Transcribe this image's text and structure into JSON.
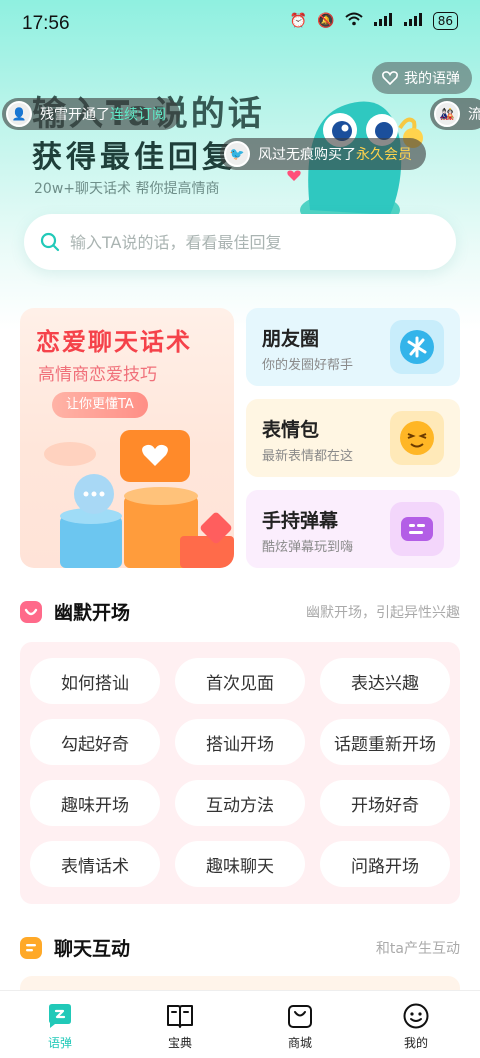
{
  "status_bar": {
    "time": "17:56",
    "battery": "86"
  },
  "hero": {
    "headline_line1": "输入Ta说的话",
    "headline_line2": "获得最佳回复",
    "subtitle": "20w+聊天话术 帮你提高情商",
    "my_danmu_label": "我的语弹"
  },
  "tickers": [
    {
      "prefix": "残雪开通了",
      "highlight": "连续订阅"
    },
    {
      "prefix": "风过无痕购买了",
      "highlight": "永久会员"
    },
    {
      "prefix": "流",
      "highlight": ""
    }
  ],
  "search": {
    "placeholder": "输入TA说的话，看看最佳回复"
  },
  "features": {
    "big": {
      "title": "恋爱聊天话术",
      "subtitle": "高情商恋爱技巧",
      "pill": "让你更懂TA"
    },
    "cards": [
      {
        "title": "朋友圈",
        "subtitle": "你的发圈好帮手"
      },
      {
        "title": "表情包",
        "subtitle": "最新表情都在这"
      },
      {
        "title": "手持弹幕",
        "subtitle": "酷炫弹幕玩到嗨"
      }
    ]
  },
  "section_humor": {
    "title": "幽默开场",
    "desc": "幽默开场，引起异性兴趣",
    "tags": [
      "如何搭讪",
      "首次见面",
      "表达兴趣",
      "勾起好奇",
      "搭讪开场",
      "话题重新开场",
      "趣味开场",
      "互动方法",
      "开场好奇",
      "表情话术",
      "趣味聊天",
      "问路开场"
    ]
  },
  "section_chat": {
    "title": "聊天互动",
    "desc": "和ta产生互动"
  },
  "nav": [
    {
      "label": "语弹",
      "icon": "chat-bubble-icon",
      "active": true
    },
    {
      "label": "宝典",
      "icon": "book-icon",
      "active": false
    },
    {
      "label": "商城",
      "icon": "shopping-bag-icon",
      "active": false
    },
    {
      "label": "我的",
      "icon": "smiley-face-icon",
      "active": false
    }
  ],
  "colors": {
    "accent": "#21c9b8",
    "pink": "#f5424a",
    "highlight_yellow": "#ffd34d"
  }
}
